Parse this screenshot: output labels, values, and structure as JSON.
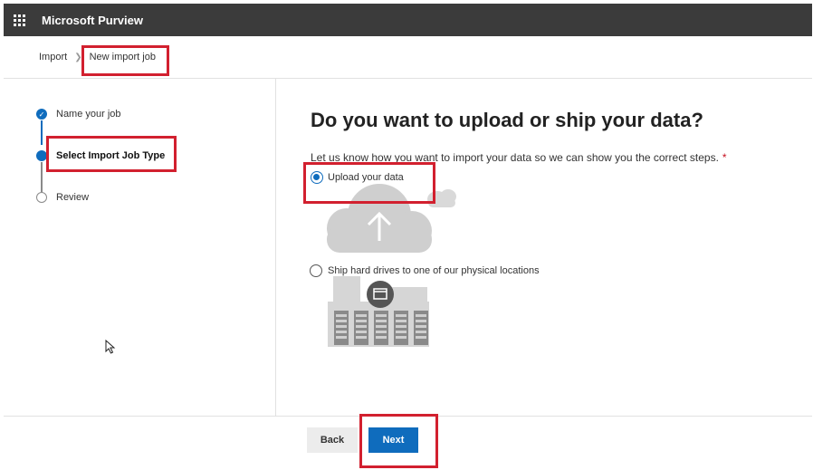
{
  "app": {
    "title": "Microsoft Purview"
  },
  "breadcrumb": {
    "items": [
      "Import",
      "New import job"
    ]
  },
  "steps": [
    {
      "label": "Name your job",
      "state": "done"
    },
    {
      "label": "Select Import Job Type",
      "state": "current"
    },
    {
      "label": "Review",
      "state": "todo"
    }
  ],
  "main": {
    "heading": "Do you want to upload or ship your data?",
    "prompt": "Let us know how you want to import your data so we can show you the correct steps.",
    "required_marker": "*",
    "options": [
      {
        "label": "Upload your data",
        "selected": true,
        "icon": "cloud-upload-icon"
      },
      {
        "label": "Ship hard drives to one of our physical locations",
        "selected": false,
        "icon": "datacenter-icon"
      }
    ]
  },
  "footer": {
    "back_label": "Back",
    "next_label": "Next"
  },
  "colors": {
    "accent": "#0f6cbd",
    "topbar": "#3b3b3b",
    "highlight": "#d2202f"
  }
}
